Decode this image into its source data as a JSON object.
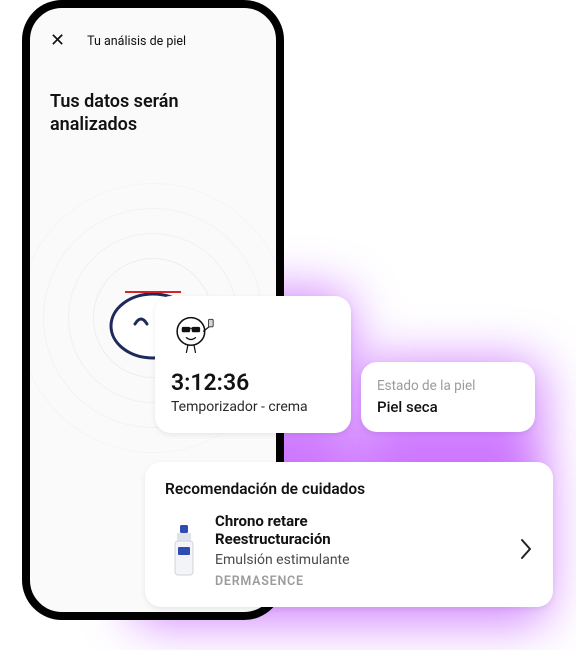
{
  "phone": {
    "header_title": "Tu análisis de piel",
    "headline": "Tus datos serán analizados"
  },
  "timer_card": {
    "value": "3:12:36",
    "label": "Temporizador - crema"
  },
  "state_card": {
    "caption": "Estado de la piel",
    "value": "Piel seca"
  },
  "reco_card": {
    "title": "Recomendación de cuidados",
    "product_name_line1": "Chrono retare",
    "product_name_line2": "Reestructuración",
    "product_sub": "Emulsión estimulante",
    "brand": "DERMASENCE"
  },
  "colors": {
    "glow": "#b028ff",
    "outline": "#1d2a5b",
    "face_red": "#d8232a"
  }
}
